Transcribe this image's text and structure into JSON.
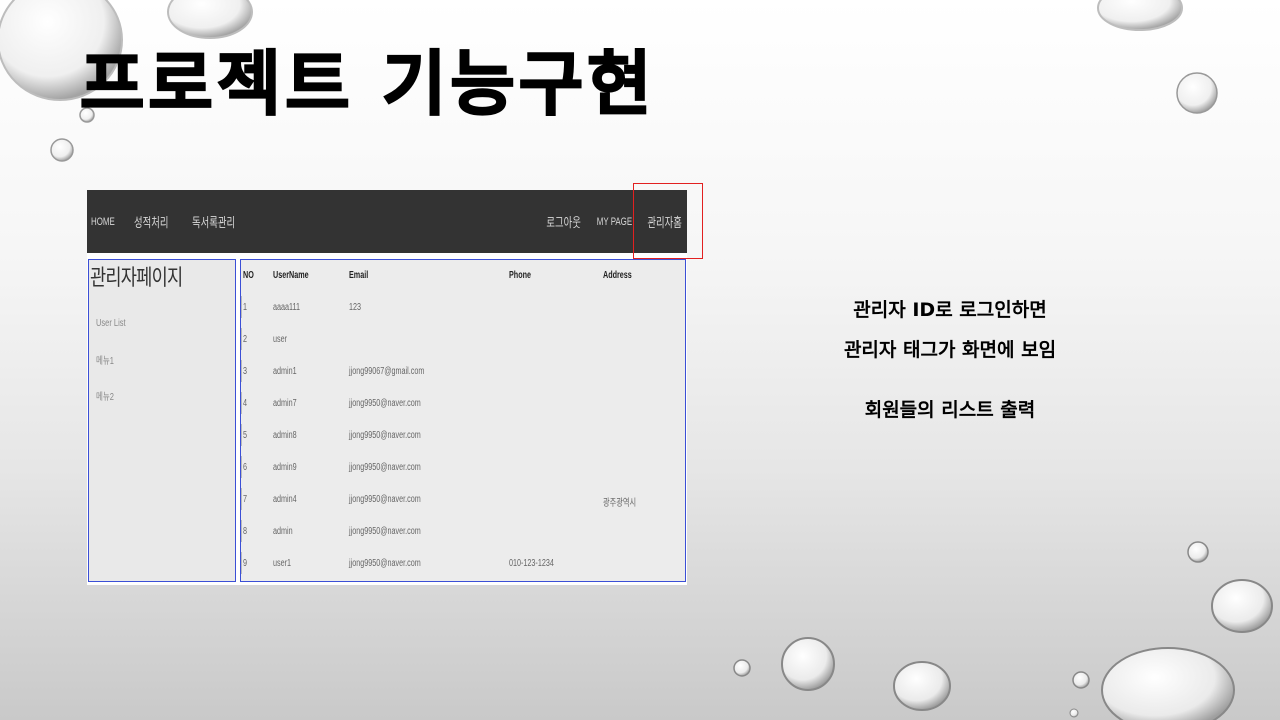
{
  "slide": {
    "title": "프로젝트 기능구현",
    "caption_line1": "관리자 ID로 로그인하면",
    "caption_line2": "관리자 태그가 화면에 보임",
    "caption_line3": "회원들의 리스트 출력"
  },
  "navbar": {
    "left_links": [
      "HOME",
      "성적처리",
      "독서록관리"
    ],
    "right_links": [
      "로그아웃",
      "MY PAGE",
      "관리자홈"
    ]
  },
  "sidebar": {
    "title": "관리자페이지",
    "items": [
      "User List",
      "메뉴1",
      "메뉴2"
    ]
  },
  "table": {
    "columns": [
      "NO",
      "UserName",
      "Email",
      "Phone",
      "Address"
    ],
    "rows": [
      [
        "1",
        "aaaa111",
        "123",
        "",
        ""
      ],
      [
        "2",
        "user",
        "",
        "",
        ""
      ],
      [
        "3",
        "admin1",
        "jjong99067@gmail.com",
        "",
        ""
      ],
      [
        "4",
        "admin7",
        "jjong9950@naver.com",
        "",
        ""
      ],
      [
        "5",
        "admin8",
        "jjong9950@naver.com",
        "",
        ""
      ],
      [
        "6",
        "admin9",
        "jjong9950@naver.com",
        "",
        ""
      ],
      [
        "7",
        "admin4",
        "jjong9950@naver.com",
        "",
        "광주광역시"
      ],
      [
        "8",
        "admin",
        "jjong9950@naver.com",
        "",
        ""
      ],
      [
        "9",
        "user1",
        "jjong9950@naver.com",
        "010-123-1234",
        ""
      ]
    ]
  },
  "colors": {
    "navbar_bg": "#333333",
    "panel_border": "#3b4fd6",
    "highlight": "#e22020"
  }
}
